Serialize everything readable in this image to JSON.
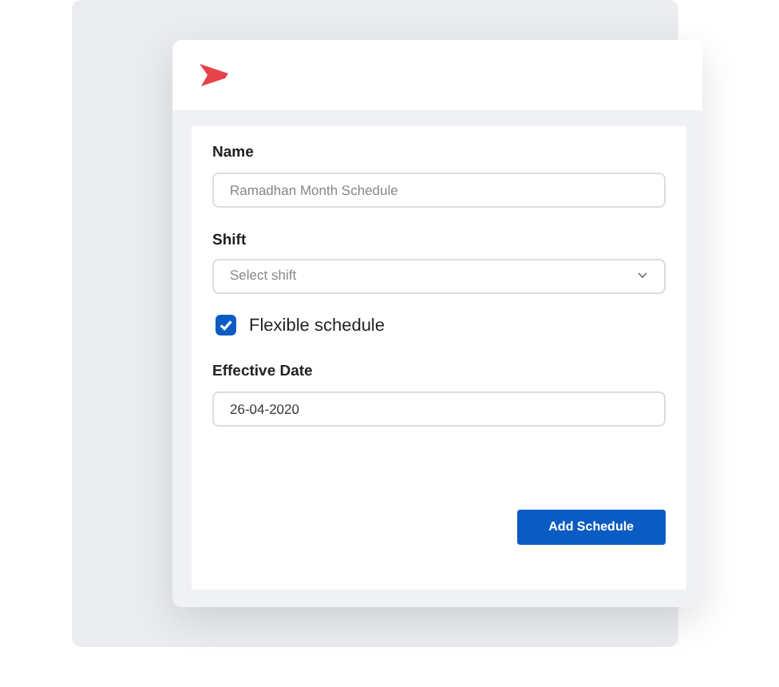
{
  "form": {
    "fields": [
      {
        "kind": "text",
        "label": "Name",
        "placeholder": "Ramadhan Month Schedule"
      },
      {
        "kind": "select",
        "label": "Shift",
        "placeholder": "Select shift"
      },
      {
        "kind": "checkbox",
        "label": "Flexible schedule",
        "checked": true
      },
      {
        "kind": "date",
        "label": "Effective Date",
        "value": "26-04-2020"
      }
    ],
    "submit": "Add Schedule"
  }
}
